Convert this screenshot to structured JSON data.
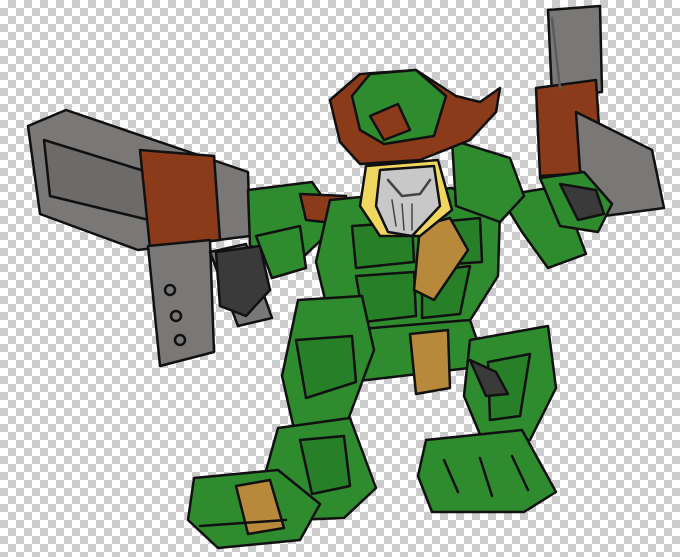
{
  "scene": {
    "background": "transparency-checkerboard",
    "subject": "robot-illustration",
    "colors": {
      "checker_light": "#ffffff",
      "checker_dark": "#cccccc",
      "armor_green": "#2e8b2e",
      "armor_green_dark": "#1f6b1f",
      "hat_brown": "#8b3a1a",
      "gun_gray": "#7a7876",
      "gun_gray_dark": "#5e5c5a",
      "tan": "#b8893a",
      "visor_yellow": "#f0d860",
      "mask_silver": "#c8c8c8",
      "outline": "#111111"
    }
  }
}
